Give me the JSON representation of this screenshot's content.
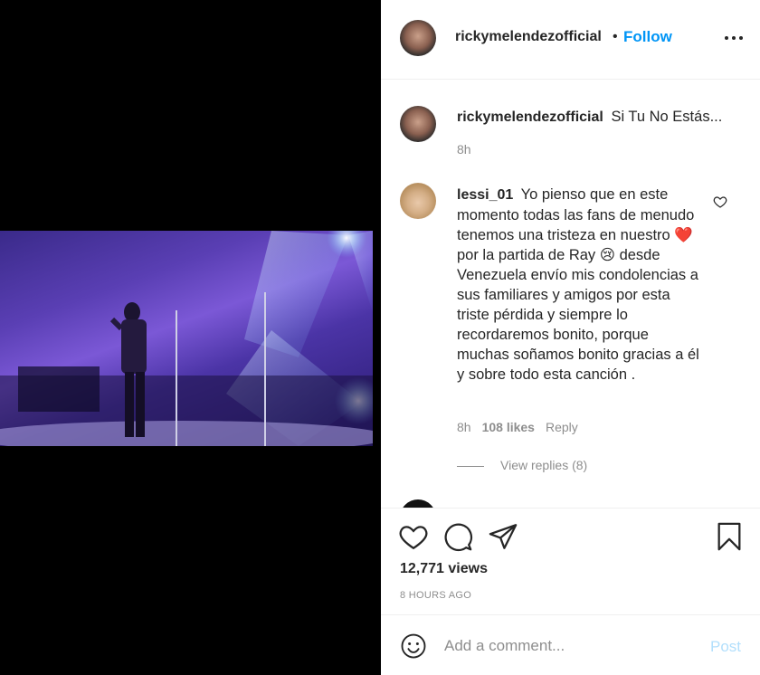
{
  "post": {
    "author": "rickymelendezofficial",
    "separator": "•",
    "follow_label": "Follow"
  },
  "caption": {
    "author": "rickymelendezofficial",
    "text": "Si Tu No Estás...",
    "time": "8h"
  },
  "comments": [
    {
      "author": "lessi_01",
      "text_parts": [
        "Yo pienso que en este momento todas las fans de menudo tenemos una tristeza en nuestro",
        "❤️",
        "por la partida de Ray",
        "😢",
        "desde Venezuela envío mis condolencias a sus familiares y amigos por esta triste pérdida y siempre lo recordaremos bonito, porque muchas soñamos bonito gracias a él y sobre todo esta canción ."
      ],
      "time": "8h",
      "likes": "108 likes",
      "reply_label": "Reply",
      "view_replies": "View replies (8)"
    }
  ],
  "stats": {
    "views": "12,771 views",
    "posted": "8 HOURS AGO"
  },
  "comment_box": {
    "placeholder": "Add a comment...",
    "post_label": "Post"
  },
  "icons": {
    "like": "heart-icon",
    "comment": "comment-icon",
    "share": "share-icon",
    "save": "bookmark-icon",
    "emoji": "emoji-icon",
    "more": "more-options-icon"
  },
  "colors": {
    "accent": "#0095f6",
    "post_disabled": "#b2dffc",
    "muted": "#8e8e8e"
  }
}
